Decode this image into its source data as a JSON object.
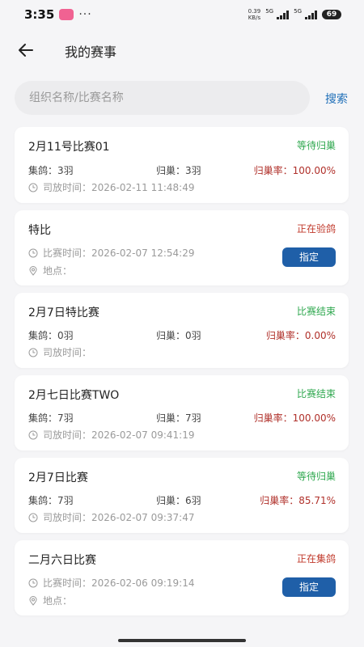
{
  "status_bar": {
    "time": "3:35",
    "more": "···",
    "net_speed": "0.39",
    "net_unit": "KB/s",
    "gen1": "5G",
    "gen2": "5G",
    "battery": "69"
  },
  "header": {
    "title": "我的赛事"
  },
  "search": {
    "placeholder": "组织名称/比赛名称",
    "value": "",
    "button": "搜索"
  },
  "colors": {
    "accent": "#1f6fb8",
    "green": "#2fa84f",
    "red": "#c0392b",
    "button": "#1f5fa8"
  },
  "labels": {
    "collected": "集鸽：",
    "returned": "归巢：",
    "return_rate": "归巢率：",
    "release_time": "司放时间：",
    "race_time": "比赛时间：",
    "location": "地点：",
    "assign": "指定"
  },
  "races": [
    {
      "title": "2月11号比赛01",
      "status": "等待归巢",
      "collected": "3羽",
      "returned": "3羽",
      "rate": "100.00%",
      "release_time": "2026-02-11 11:48:49"
    },
    {
      "title": "特比",
      "status": "正在验鸽",
      "race_time": "2026-02-07 12:54:29",
      "location": ""
    },
    {
      "title": "2月7日特比赛",
      "status": "比赛结束",
      "collected": "0羽",
      "returned": "0羽",
      "rate": "0.00%",
      "release_time": ""
    },
    {
      "title": "2月七日比赛TWO",
      "status": "比赛结束",
      "collected": "7羽",
      "returned": "7羽",
      "rate": "100.00%",
      "release_time": "2026-02-07 09:41:19"
    },
    {
      "title": "2月7日比赛",
      "status": "等待归巢",
      "collected": "7羽",
      "returned": "6羽",
      "rate": "85.71%",
      "release_time": "2026-02-07 09:37:47"
    },
    {
      "title": "二月六日比赛",
      "status": "正在集鸽",
      "race_time": "2026-02-06 09:19:14",
      "location": ""
    }
  ]
}
